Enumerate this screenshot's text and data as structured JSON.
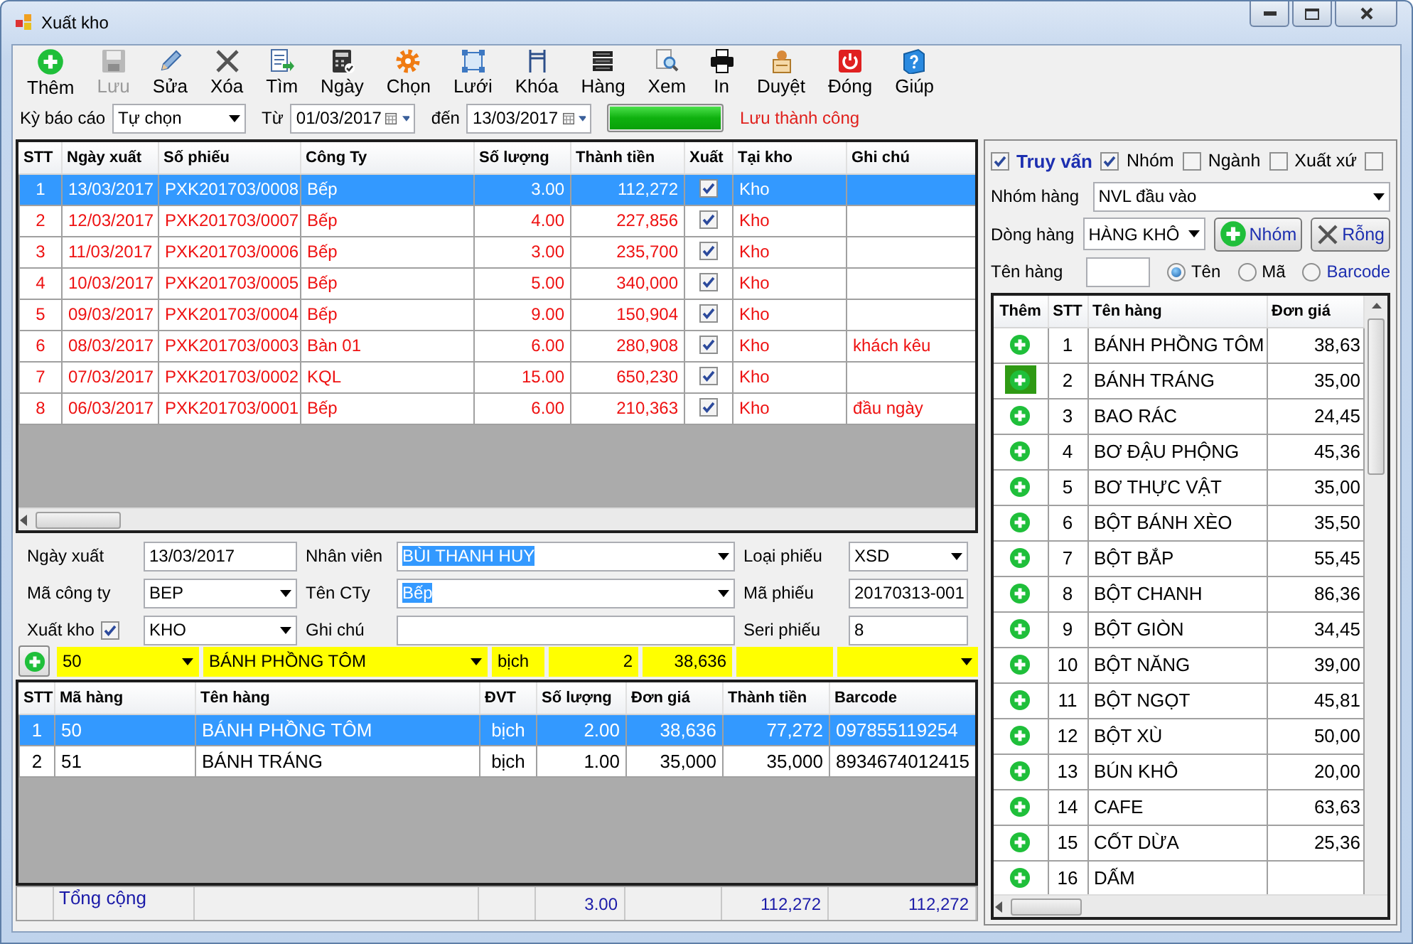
{
  "window": {
    "title": "Xuất kho"
  },
  "toolbar": [
    {
      "label": "Thêm",
      "kind": "add",
      "disabled": false
    },
    {
      "label": "Lưu",
      "kind": "save",
      "disabled": true
    },
    {
      "label": "Sửa",
      "kind": "edit",
      "disabled": false
    },
    {
      "label": "Xóa",
      "kind": "delete",
      "disabled": false
    },
    {
      "label": "Tìm",
      "kind": "find",
      "disabled": false
    },
    {
      "label": "Ngày",
      "kind": "calc",
      "disabled": false
    },
    {
      "label": "Chọn",
      "kind": "gear",
      "disabled": false
    },
    {
      "label": "Lưới",
      "kind": "frame",
      "disabled": false
    },
    {
      "label": "Khóa",
      "kind": "bracket",
      "disabled": false
    },
    {
      "label": "Hàng",
      "kind": "books",
      "disabled": false
    },
    {
      "label": "Xem",
      "kind": "preview",
      "disabled": false
    },
    {
      "label": "In",
      "kind": "print",
      "disabled": false
    },
    {
      "label": "Duyệt",
      "kind": "approve",
      "disabled": false
    },
    {
      "label": "Đóng",
      "kind": "power",
      "disabled": false
    },
    {
      "label": "Giúp",
      "kind": "help",
      "disabled": false
    }
  ],
  "filter": {
    "period_label": "Kỳ báo cáo",
    "period": "Tự chọn",
    "from_label": "Từ",
    "from": "01/03/2017",
    "to_label": "đến",
    "to": "13/03/2017",
    "progress": {
      "level": 1
    },
    "status": "Lưu thành công"
  },
  "vouchers": {
    "columns": [
      "STT",
      "Ngày xuất",
      "Số phiếu",
      "Công Ty",
      "Số lượng",
      "Thành tiền",
      "Xuất",
      "Tại kho",
      "Ghi chú"
    ],
    "rows": [
      {
        "stt": "1",
        "date": "13/03/2017",
        "number": "PXK201703/0008",
        "company": "Bếp",
        "quantity": "3.00",
        "amount": "112,272",
        "exported": true,
        "warehouse": "Kho",
        "selected": true
      },
      {
        "stt": "2",
        "date": "12/03/2017",
        "number": "PXK201703/0007",
        "company": "Bếp",
        "quantity": "4.00",
        "amount": "227,856",
        "exported": true,
        "warehouse": "Kho",
        "selected": false
      },
      {
        "stt": "3",
        "date": "11/03/2017",
        "number": "PXK201703/0006",
        "company": "Bếp",
        "quantity": "3.00",
        "amount": "235,700",
        "exported": true,
        "warehouse": "Kho",
        "selected": false
      },
      {
        "stt": "4",
        "date": "10/03/2017",
        "number": "PXK201703/0005",
        "company": "Bếp",
        "quantity": "5.00",
        "amount": "340,000",
        "exported": true,
        "warehouse": "Kho",
        "selected": false
      },
      {
        "stt": "5",
        "date": "09/03/2017",
        "number": "PXK201703/0004",
        "company": "Bếp",
        "quantity": "9.00",
        "amount": "150,904",
        "exported": true,
        "warehouse": "Kho",
        "selected": false
      },
      {
        "stt": "6",
        "date": "08/03/2017",
        "number": "PXK201703/0003",
        "company": "Bàn 01",
        "quantity": "6.00",
        "amount": "280,908",
        "exported": true,
        "warehouse": "Kho",
        "note": "khách kêu",
        "selected": false
      },
      {
        "stt": "7",
        "date": "07/03/2017",
        "number": "PXK201703/0002",
        "company": "KQL",
        "quantity": "15.00",
        "amount": "650,230",
        "exported": true,
        "warehouse": "Kho",
        "selected": false
      },
      {
        "stt": "8",
        "date": "06/03/2017",
        "number": "PXK201703/0001",
        "company": "Bếp",
        "quantity": "6.00",
        "amount": "210,363",
        "exported": true,
        "warehouse": "Kho",
        "note": "đầu ngày",
        "selected": false
      }
    ]
  },
  "form": {
    "fields": [
      {
        "label": "Ngày xuất",
        "value": "13/03/2017",
        "kind": "text",
        "highlighted": false
      },
      {
        "label": "Nhân viên",
        "value": "BÙI THANH HUY",
        "kind": "combo",
        "highlighted": true
      },
      {
        "label": "Loại phiếu",
        "value": "XSD",
        "kind": "combo",
        "highlighted": false
      },
      {
        "label": "Mã công ty",
        "value": "BEP",
        "kind": "combo",
        "highlighted": false
      },
      {
        "label": "Tên CTy",
        "value": "Bếp",
        "kind": "combo",
        "highlighted": true
      },
      {
        "label": "Mã phiếu",
        "value": "20170313-001",
        "kind": "text",
        "highlighted": false
      },
      {
        "label": "Xuất kho",
        "value": "KHO",
        "kind": "check-combo",
        "checked": true,
        "highlighted": false
      },
      {
        "label": "Ghi chú",
        "kind": "text"
      },
      {
        "label": "Seri phiếu",
        "value": "8",
        "kind": "text",
        "highlighted": false
      }
    ]
  },
  "entry": {
    "fields": [
      {
        "kind": "combo",
        "value": "50"
      },
      {
        "kind": "combo",
        "value": "BÁNH PHỒNG TÔM"
      },
      {
        "kind": "text",
        "value": "bịch"
      },
      {
        "kind": "number",
        "value": "2"
      },
      {
        "kind": "number",
        "value": "38,636"
      },
      {
        "kind": "text"
      },
      {
        "kind": "combo"
      }
    ]
  },
  "items": {
    "columns": [
      "STT",
      "Mã hàng",
      "Tên hàng",
      "ĐVT",
      "Số lượng",
      "Đơn giá",
      "Thành tiền",
      "Barcode"
    ],
    "rows": [
      {
        "stt": "1",
        "code": "50",
        "name": "BÁNH PHỒNG TÔM",
        "unit": "bịch",
        "quantity": "2.00",
        "price": "38,636",
        "amount": "77,272",
        "barcode": "097855119254",
        "selected": true
      },
      {
        "stt": "2",
        "code": "51",
        "name": "BÁNH TRÁNG",
        "unit": "bịch",
        "quantity": "1.00",
        "price": "35,000",
        "amount": "35,000",
        "barcode": "8934674012415",
        "selected": false
      }
    ],
    "totals": {
      "label": "Tổng cộng",
      "quantity": "3.00",
      "amount": "112,272",
      "column_8": "112,272"
    }
  },
  "lookup": {
    "filters": [
      {
        "label": "Truy vấn",
        "checked": true
      },
      {
        "label": "Nhóm",
        "checked": true
      },
      {
        "label": "Ngành",
        "checked": false
      },
      {
        "label": "Xuất xứ",
        "checked": false
      },
      {
        "checked": false
      }
    ],
    "group_label": "Nhóm hàng",
    "group": "NVL đầu vào",
    "line_label": "Dòng hàng",
    "line": "HÀNG KHÔ",
    "buttons": [
      {
        "label": "Nhóm",
        "kind": "add"
      },
      {
        "label": "Rỗng",
        "kind": "clear"
      }
    ],
    "name_label": "Tên hàng",
    "search_by": [
      {
        "label": "Tên",
        "selected": true
      },
      {
        "label": "Mã",
        "selected": false
      },
      {
        "label": "Barcode",
        "selected": false
      }
    ],
    "products": {
      "columns": [
        "Thêm",
        "STT",
        "Tên hàng",
        "Đơn giá"
      ],
      "rows": [
        {
          "stt": "1",
          "name": "BÁNH PHỒNG TÔM",
          "price": "38,63",
          "hovered": false
        },
        {
          "stt": "2",
          "name": "BÁNH TRÁNG",
          "price": "35,00",
          "hovered": true
        },
        {
          "stt": "3",
          "name": "BAO RÁC",
          "price": "24,45",
          "hovered": false
        },
        {
          "stt": "4",
          "name": "BƠ ĐẬU PHỘNG",
          "price": "45,36",
          "hovered": false
        },
        {
          "stt": "5",
          "name": "BƠ THỰC VẬT",
          "price": "35,00",
          "hovered": false
        },
        {
          "stt": "6",
          "name": "BỘT BÁNH XÈO",
          "price": "35,50",
          "hovered": false
        },
        {
          "stt": "7",
          "name": "BỘT BẮP",
          "price": "55,45",
          "hovered": false
        },
        {
          "stt": "8",
          "name": "BỘT CHANH",
          "price": "86,36",
          "hovered": false
        },
        {
          "stt": "9",
          "name": "BỘT GIÒN",
          "price": "34,45",
          "hovered": false
        },
        {
          "stt": "10",
          "name": "BỘT NĂNG",
          "price": "39,00",
          "hovered": false
        },
        {
          "stt": "11",
          "name": "BỘT NGỌT",
          "price": "45,81",
          "hovered": false
        },
        {
          "stt": "12",
          "name": "BỘT XÙ",
          "price": "50,00",
          "hovered": false
        },
        {
          "stt": "13",
          "name": "BÚN KHÔ",
          "price": "20,00",
          "hovered": false
        },
        {
          "stt": "14",
          "name": "CAFE",
          "price": "63,63",
          "hovered": false
        },
        {
          "stt": "15",
          "name": "CỐT DỪA",
          "price": "25,36",
          "hovered": false
        },
        {
          "stt": "16",
          "name": "DẤM",
          "hovered": false
        }
      ]
    }
  }
}
